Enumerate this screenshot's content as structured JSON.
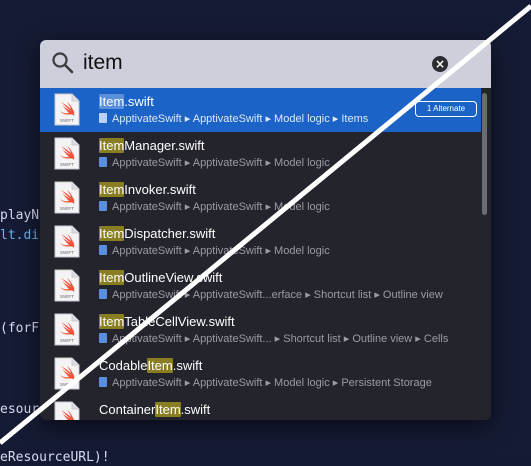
{
  "search": {
    "query": "item",
    "clear_icon": "x-circle-icon",
    "search_icon": "magnifier-icon"
  },
  "background_code": {
    "line1": "playNa",
    "line2": "lt.dis",
    "line3": "(forFi",
    "line4": "esourc",
    "line5": "eResourceURL)!"
  },
  "results": [
    {
      "pre": "",
      "match": "Item",
      "post": ".swift",
      "path": "ApptivateSwift ▸ ApptivateSwift ▸ Model logic ▸ Items",
      "badge": "1 Alternate"
    },
    {
      "pre": "",
      "match": "Item",
      "post": "Manager.swift",
      "path": "ApptivateSwift ▸ ApptivateSwift ▸ Model logic"
    },
    {
      "pre": "",
      "match": "Item",
      "post": "Invoker.swift",
      "path": "ApptivateSwift ▸ ApptivateSwift ▸ Model logic"
    },
    {
      "pre": "",
      "match": "Item",
      "post": "Dispatcher.swift",
      "path": "ApptivateSwift ▸ ApptivateSwift ▸ Model logic"
    },
    {
      "pre": "",
      "match": "Item",
      "post": "OutlineView.swift",
      "path": "ApptivateSwift ▸ ApptivateSwift...erface ▸ Shortcut list ▸ Outline view"
    },
    {
      "pre": "",
      "match": "Item",
      "post": "TableCellView.swift",
      "path": "ApptivateSwift ▸ ApptivateSwift... ▸ Shortcut list ▸ Outline view ▸ Cells"
    },
    {
      "pre": "Codable",
      "match": "Item",
      "post": ".swift",
      "path": "ApptivateSwift ▸ ApptivateSwift ▸ Model logic ▸ Persistent Storage"
    },
    {
      "pre": "Container",
      "match": "Item",
      "post": ".swift",
      "path": ""
    }
  ],
  "file_icon_label": "SWIFT",
  "colors": {
    "selected": "#1b63c6",
    "highlight": "#8a7e22",
    "swift": "#f05138"
  }
}
